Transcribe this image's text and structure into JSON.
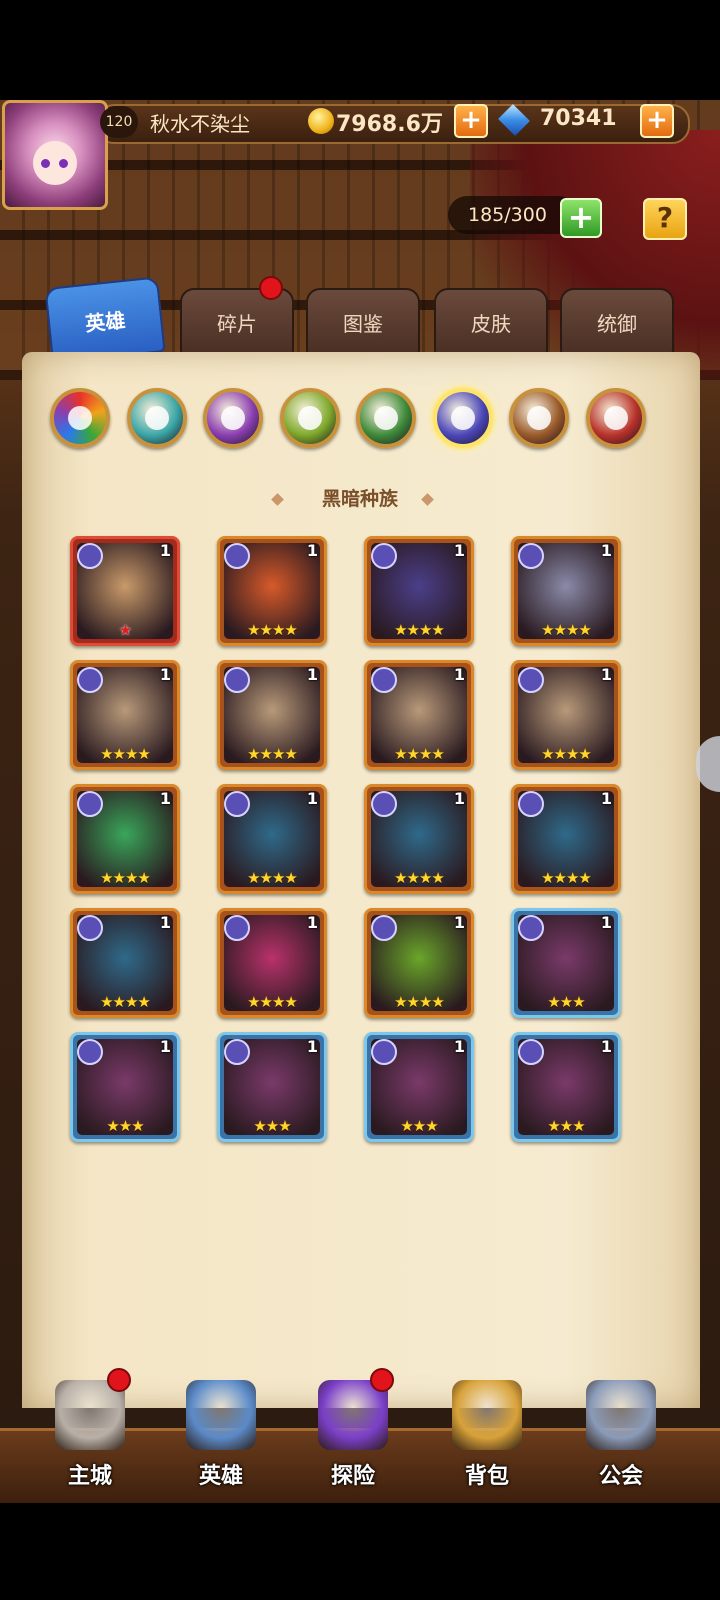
{
  "player": {
    "level": "120",
    "name": "秋水不染尘",
    "gold": "7968.6万",
    "gems": "70341"
  },
  "inventory": {
    "capacity": "185/300"
  },
  "tabs": [
    {
      "label": "英雄",
      "active": true
    },
    {
      "label": "碎片",
      "active": false,
      "notification": true
    },
    {
      "label": "图鉴",
      "active": false
    },
    {
      "label": "皮肤",
      "active": false
    },
    {
      "label": "统御",
      "active": false
    }
  ],
  "races": [
    {
      "icon": "all-races-icon",
      "color": "#e85a2a"
    },
    {
      "icon": "water-race-icon",
      "color": "#3aa6a6"
    },
    {
      "icon": "mystic-race-icon",
      "color": "#8a3fb0"
    },
    {
      "icon": "nature-race-icon",
      "color": "#7ca82a"
    },
    {
      "icon": "forest-race-icon",
      "color": "#3f8a3a"
    },
    {
      "icon": "dark-race-icon",
      "color": "#4b47b8",
      "selected": true
    },
    {
      "icon": "light-race-icon",
      "color": "#9a5a2a"
    },
    {
      "icon": "fire-race-icon",
      "color": "#b8322a"
    }
  ],
  "section_title": "黑暗种族",
  "heroes": [
    {
      "portrait": "dwarf-king",
      "level": "1",
      "stars": "★",
      "frame": "red",
      "hue": "#c99a6a"
    },
    {
      "portrait": "fire-beast",
      "level": "1",
      "stars": "★★★★",
      "frame": "orange",
      "hue": "#d75a2a"
    },
    {
      "portrait": "dark-troll",
      "level": "1",
      "stars": "★★★★",
      "frame": "orange",
      "hue": "#4b3f8a"
    },
    {
      "portrait": "ghost-woman",
      "level": "1",
      "stars": "★★★★",
      "frame": "orange",
      "hue": "#8a8aa8"
    },
    {
      "portrait": "dwarf-elder",
      "level": "1",
      "stars": "★★★★",
      "frame": "orange",
      "hue": "#b89a7a"
    },
    {
      "portrait": "dwarf-elder",
      "level": "1",
      "stars": "★★★★",
      "frame": "orange",
      "hue": "#b89a7a"
    },
    {
      "portrait": "dwarf-elder",
      "level": "1",
      "stars": "★★★★",
      "frame": "orange",
      "hue": "#b89a7a"
    },
    {
      "portrait": "dwarf-elder",
      "level": "1",
      "stars": "★★★★",
      "frame": "orange",
      "hue": "#b89a7a"
    },
    {
      "portrait": "swamp-monster",
      "level": "1",
      "stars": "★★★★",
      "frame": "orange",
      "hue": "#3aa65a"
    },
    {
      "portrait": "skull-bird",
      "level": "1",
      "stars": "★★★★",
      "frame": "orange",
      "hue": "#2f6a8a"
    },
    {
      "portrait": "skull-bird",
      "level": "1",
      "stars": "★★★★",
      "frame": "orange",
      "hue": "#2f6a8a"
    },
    {
      "portrait": "skull-bird",
      "level": "1",
      "stars": "★★★★",
      "frame": "orange",
      "hue": "#2f6a8a"
    },
    {
      "portrait": "skull-bird",
      "level": "1",
      "stars": "★★★★",
      "frame": "orange",
      "hue": "#2f6a8a"
    },
    {
      "portrait": "crowned-imp",
      "level": "1",
      "stars": "★★★★",
      "frame": "orange",
      "hue": "#b8326a"
    },
    {
      "portrait": "twin-orcs",
      "level": "1",
      "stars": "★★★★",
      "frame": "orange",
      "hue": "#6aa62a"
    },
    {
      "portrait": "armored-bird",
      "level": "1",
      "stars": "★★★",
      "frame": "blue",
      "hue": "#7a3a6a"
    },
    {
      "portrait": "armored-bird",
      "level": "1",
      "stars": "★★★",
      "frame": "blue",
      "hue": "#7a3a6a"
    },
    {
      "portrait": "armored-bird",
      "level": "1",
      "stars": "★★★",
      "frame": "blue",
      "hue": "#7a3a6a"
    },
    {
      "portrait": "armored-bird",
      "level": "1",
      "stars": "★★★",
      "frame": "blue",
      "hue": "#7a3a6a"
    },
    {
      "portrait": "armored-bird",
      "level": "1",
      "stars": "★★★",
      "frame": "blue",
      "hue": "#7a3a6a"
    }
  ],
  "nav": [
    {
      "label": "主城",
      "icon": "castle-icon",
      "notification": true
    },
    {
      "label": "英雄",
      "icon": "hero-icon",
      "notification": false
    },
    {
      "label": "探险",
      "icon": "portal-icon",
      "notification": true
    },
    {
      "label": "背包",
      "icon": "backpack-icon",
      "notification": false
    },
    {
      "label": "公会",
      "icon": "guild-tower-icon",
      "notification": false
    }
  ]
}
